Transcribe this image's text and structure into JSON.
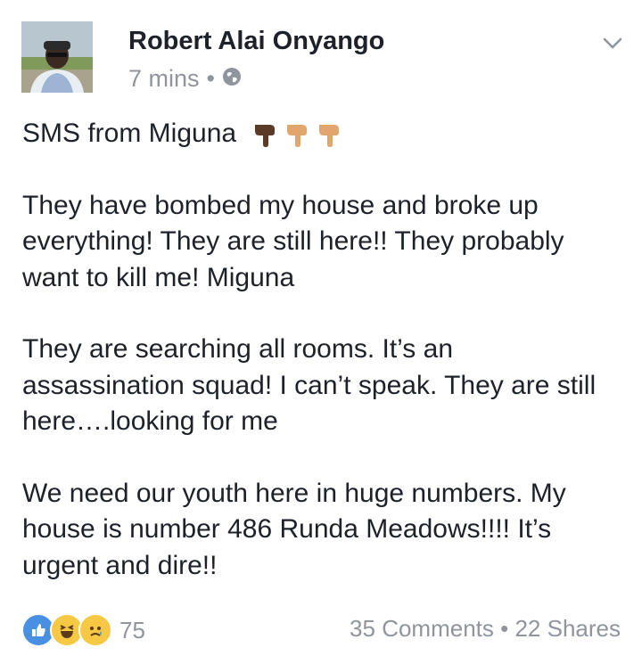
{
  "post": {
    "author": "Robert Alai Onyango",
    "time": "7 mins",
    "separator": "•",
    "audience_icon": "globe-icon",
    "menu_icon": "chevron-down-icon",
    "paragraphs": [
      "SMS from Miguna",
      "They have bombed my house and broke up everything! They are still here!! They probably want to kill me! Miguna",
      "They are searching all rooms. It’s an assassination squad! I can’t speak. They are still here….looking for me",
      "We need our youth here in huge numbers. My house is number 486 Runda Meadows!!!! It’s urgent and dire!!"
    ],
    "emoji": [
      "pointing-down-hand-dark",
      "pointing-down-hand-light",
      "pointing-down-hand-light"
    ]
  },
  "footer": {
    "reaction_icons": [
      "like-icon",
      "haha-icon",
      "sad-icon"
    ],
    "reaction_count": "75",
    "comments": "35 Comments",
    "dot": "•",
    "shares": "22 Shares"
  },
  "colors": {
    "text": "#1d2129",
    "muted": "#90949c",
    "like_blue": "#4a90e2",
    "emoji_yellow": "#f7c843"
  }
}
